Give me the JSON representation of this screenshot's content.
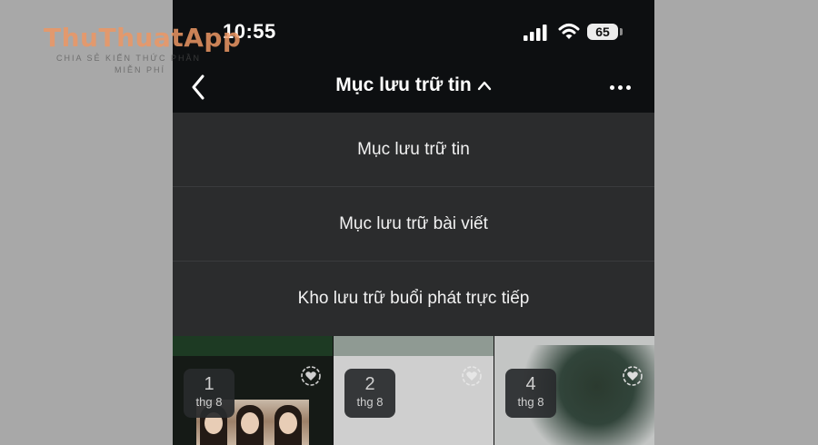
{
  "watermark": {
    "logo": "ThuThuatApp",
    "tagline_line1": "CHIA SẺ KIẾN THỨC PHẦN",
    "tagline_line2": "MIỄN PHÍ"
  },
  "status_bar": {
    "time": "10:55",
    "battery": "65"
  },
  "nav": {
    "title": "Mục lưu trữ tin"
  },
  "dropdown": {
    "items": [
      {
        "label": "Mục lưu trữ tin"
      },
      {
        "label": "Mục lưu trữ bài viết"
      },
      {
        "label": "Kho lưu trữ buổi phát trực tiếp"
      }
    ]
  },
  "grid": {
    "cells": [
      {
        "day": "1",
        "month": "thg 8"
      },
      {
        "day": "2",
        "month": "thg 8"
      },
      {
        "day": "4",
        "month": "thg 8"
      }
    ]
  },
  "colors": {
    "background": "#a8a8a8",
    "phone_bg": "#0d0f11",
    "dropdown_bg": "#2b2c2d",
    "text": "#ffffff",
    "watermark_accent": "#ec9664"
  },
  "icons": {
    "back": "back-chevron-icon",
    "title_caret": "chevron-up-icon",
    "more": "more-horizontal-icon",
    "highlight": "heart-circle-icon",
    "signal": "cellular-signal-icon",
    "wifi": "wifi-icon",
    "battery": "battery-icon"
  }
}
